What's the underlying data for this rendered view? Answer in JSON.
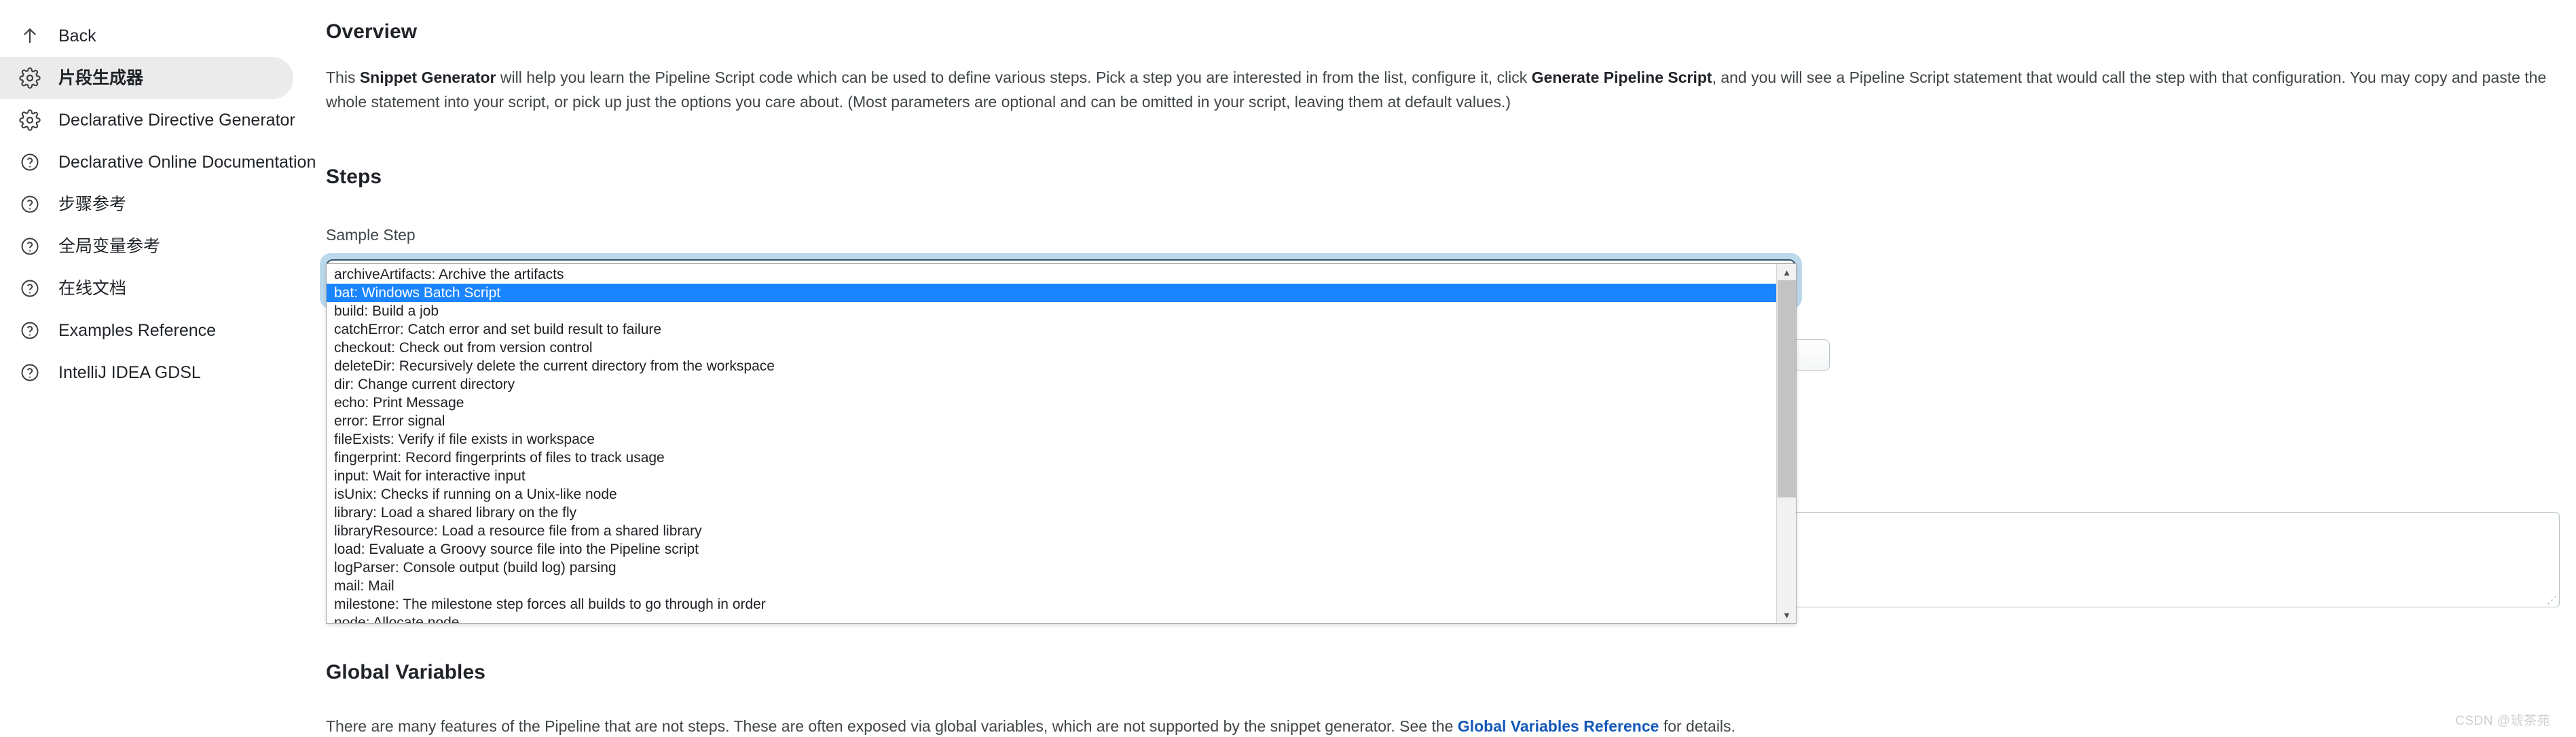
{
  "sidebar": {
    "items": [
      {
        "label": "Back",
        "icon": "arrow-up-icon",
        "name": "back",
        "active": false
      },
      {
        "label": "片段生成器",
        "icon": "gear-icon",
        "name": "snippet-generator",
        "active": true
      },
      {
        "label": "Declarative Directive Generator",
        "icon": "gear-icon",
        "name": "declarative-directive-generator",
        "active": false
      },
      {
        "label": "Declarative Online Documentation",
        "icon": "help-circle-icon",
        "name": "declarative-online-documentation",
        "active": false
      },
      {
        "label": "步骤参考",
        "icon": "help-circle-icon",
        "name": "steps-reference",
        "active": false
      },
      {
        "label": "全局变量参考",
        "icon": "help-circle-icon",
        "name": "global-variable-reference",
        "active": false
      },
      {
        "label": "在线文档",
        "icon": "help-circle-icon",
        "name": "online-documentation",
        "active": false
      },
      {
        "label": "Examples Reference",
        "icon": "help-circle-icon",
        "name": "examples-reference",
        "active": false
      },
      {
        "label": "IntelliJ IDEA GDSL",
        "icon": "help-circle-icon",
        "name": "intellij-idea-gdsl",
        "active": false
      }
    ]
  },
  "overview": {
    "heading": "Overview",
    "paragraph_part1": "This ",
    "paragraph_bold1": "Snippet Generator",
    "paragraph_part2": " will help you learn the Pipeline Script code which can be used to define various steps. Pick a step you are interested in from the list, configure it, click ",
    "paragraph_bold2": "Generate Pipeline Script",
    "paragraph_part3": ", and you will see a Pipeline Script statement that would call the step with that configuration. You may copy and paste the whole statement into your script, or pick up just the options you care about. (Most parameters are optional and can be omitted in your script, leaving them at default values.)"
  },
  "steps": {
    "heading": "Steps",
    "field_label": "Sample Step",
    "selected_value": "archiveArtifacts: Archive the artifacts",
    "chevron_icon": "chevron-down-icon",
    "options": [
      {
        "label": "archiveArtifacts: Archive the artifacts",
        "selected": false
      },
      {
        "label": "bat: Windows Batch Script",
        "selected": true
      },
      {
        "label": "build: Build a job",
        "selected": false
      },
      {
        "label": "catchError: Catch error and set build result to failure",
        "selected": false
      },
      {
        "label": "checkout: Check out from version control",
        "selected": false
      },
      {
        "label": "deleteDir: Recursively delete the current directory from the workspace",
        "selected": false
      },
      {
        "label": "dir: Change current directory",
        "selected": false
      },
      {
        "label": "echo: Print Message",
        "selected": false
      },
      {
        "label": "error: Error signal",
        "selected": false
      },
      {
        "label": "fileExists: Verify if file exists in workspace",
        "selected": false
      },
      {
        "label": "fingerprint: Record fingerprints of files to track usage",
        "selected": false
      },
      {
        "label": "input: Wait for interactive input",
        "selected": false
      },
      {
        "label": "isUnix: Checks if running on a Unix-like node",
        "selected": false
      },
      {
        "label": "library: Load a shared library on the fly",
        "selected": false
      },
      {
        "label": "libraryResource: Load a resource file from a shared library",
        "selected": false
      },
      {
        "label": "load: Evaluate a Groovy source file into the Pipeline script",
        "selected": false
      },
      {
        "label": "logParser: Console output (build log) parsing",
        "selected": false
      },
      {
        "label": "mail: Mail",
        "selected": false
      },
      {
        "label": "milestone: The milestone step forces all builds to go through in order",
        "selected": false
      },
      {
        "label": "node: Allocate node",
        "selected": false
      }
    ],
    "scroll_up_icon": "triangle-up-icon",
    "scroll_down_icon": "triangle-down-icon"
  },
  "global_variables": {
    "heading": "Global Variables",
    "text_before": "There are many features of the Pipeline that are not steps. These are often exposed via global variables, which are not supported by the snippet generator. See the ",
    "link_label": "Global Variables Reference",
    "text_after": " for details."
  },
  "watermark": {
    "text": "CSDN @琥茶苑"
  },
  "colors": {
    "accent_selected": "#1a85ff",
    "link": "#1458b8",
    "focus_ring": "#bcd9ec",
    "select_border": "#32556a",
    "sidebar_active_bg": "#ebebeb"
  }
}
